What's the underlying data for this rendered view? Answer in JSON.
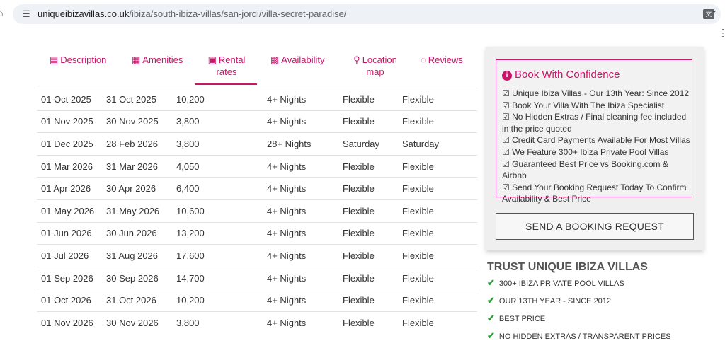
{
  "browser": {
    "url_host": "uniqueibizavillas.co.uk",
    "url_path": "/ibiza/south-ibiza-villas/san-jordi/villa-secret-paradise/"
  },
  "tabs": [
    {
      "label": "Description",
      "icon": "document-icon"
    },
    {
      "label": "Amenities",
      "icon": "list-icon"
    },
    {
      "label": "Rental rates",
      "icon": "money-icon",
      "active": true
    },
    {
      "label": "Availability",
      "icon": "calendar-check-icon"
    },
    {
      "label": "Location map",
      "icon": "map-marker-icon"
    },
    {
      "label": "Reviews",
      "icon": "comment-icon"
    }
  ],
  "rates": [
    [
      "01 Oct 2025",
      "31 Oct 2025",
      "10,200",
      "4+ Nights",
      "Flexible",
      "Flexible"
    ],
    [
      "01 Nov 2025",
      "30 Nov 2025",
      "3,800",
      "4+ Nights",
      "Flexible",
      "Flexible"
    ],
    [
      "01 Dec 2025",
      "28 Feb 2026",
      "3,800",
      "28+ Nights",
      "Saturday",
      "Saturday"
    ],
    [
      "01 Mar 2026",
      "31 Mar 2026",
      "4,050",
      "4+ Nights",
      "Flexible",
      "Flexible"
    ],
    [
      "01 Apr 2026",
      "30 Apr 2026",
      "6,400",
      "4+ Nights",
      "Flexible",
      "Flexible"
    ],
    [
      "01 May 2026",
      "31 May 2026",
      "10,600",
      "4+ Nights",
      "Flexible",
      "Flexible"
    ],
    [
      "01 Jun 2026",
      "30 Jun 2026",
      "13,200",
      "4+ Nights",
      "Flexible",
      "Flexible"
    ],
    [
      "01 Jul 2026",
      "31 Aug 2026",
      "17,600",
      "4+ Nights",
      "Flexible",
      "Flexible"
    ],
    [
      "01 Sep 2026",
      "30 Sep 2026",
      "14,700",
      "4+ Nights",
      "Flexible",
      "Flexible"
    ],
    [
      "01 Oct 2026",
      "31 Oct 2026",
      "10,200",
      "4+ Nights",
      "Flexible",
      "Flexible"
    ],
    [
      "01 Nov 2026",
      "30 Nov 2026",
      "3,800",
      "4+ Nights",
      "Flexible",
      "Flexible"
    ]
  ],
  "sidebar": {
    "confidence_title": "Book With Confidence",
    "confidence_items": [
      "☑ Unique Ibiza Villas - Our 13th Year: Since 2012",
      "☑ Book Your Villa With The Ibiza Specialist",
      "☑ No Hidden Extras / Final cleaning fee included in the price quoted",
      "☑ Credit Card Payments Available For Most Villas",
      "☑ We Feature 300+ Ibiza Private Pool Villas",
      "☑ Guaranteed Best Price vs Booking.com & Airbnb",
      "☑ Send Your Booking Request Today To Confirm Availability & Best Price"
    ],
    "booking_button": "SEND A BOOKING REQUEST"
  },
  "trust": {
    "title": "TRUST UNIQUE IBIZA VILLAS",
    "items": [
      "300+ IBIZA PRIVATE POOL VILLAS",
      "OUR 13TH YEAR - SINCE 2012",
      "BEST PRICE",
      "NO HIDDEN EXTRAS / TRANSPARENT PRICES"
    ]
  },
  "colors": {
    "accent": "#c7166a",
    "check": "#2e9e3e"
  }
}
